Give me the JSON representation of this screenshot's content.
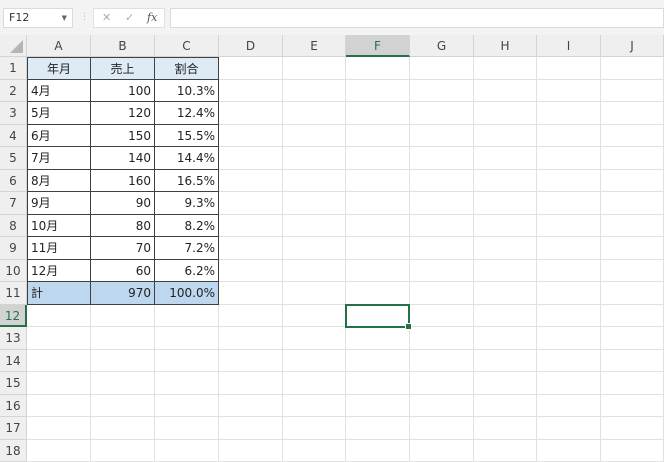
{
  "name_box": "F12",
  "formula_bar": {
    "cancel_icon": "✕",
    "enter_icon": "✓",
    "fx_label": "fx",
    "value": ""
  },
  "columns": [
    "A",
    "B",
    "C",
    "D",
    "E",
    "F",
    "G",
    "H",
    "I",
    "J"
  ],
  "rows": [
    "1",
    "2",
    "3",
    "4",
    "5",
    "6",
    "7",
    "8",
    "9",
    "10",
    "11",
    "12",
    "13",
    "14",
    "15",
    "16",
    "17",
    "18"
  ],
  "selected_cell": {
    "column": "F",
    "row": "12"
  },
  "table": {
    "headers": [
      "年月",
      "売上",
      "割合"
    ],
    "data": [
      [
        "4月",
        "100",
        "10.3%"
      ],
      [
        "5月",
        "120",
        "12.4%"
      ],
      [
        "6月",
        "150",
        "15.5%"
      ],
      [
        "7月",
        "140",
        "14.4%"
      ],
      [
        "8月",
        "160",
        "16.5%"
      ],
      [
        "9月",
        "90",
        "9.3%"
      ],
      [
        "10月",
        "80",
        "8.2%"
      ],
      [
        "11月",
        "70",
        "7.2%"
      ],
      [
        "12月",
        "60",
        "6.2%"
      ]
    ],
    "total": [
      "計",
      "970",
      "100.0%"
    ]
  },
  "colors": {
    "accent": "#217346",
    "header_fill": "#ddebf7",
    "total_fill": "#bdd7ee"
  }
}
